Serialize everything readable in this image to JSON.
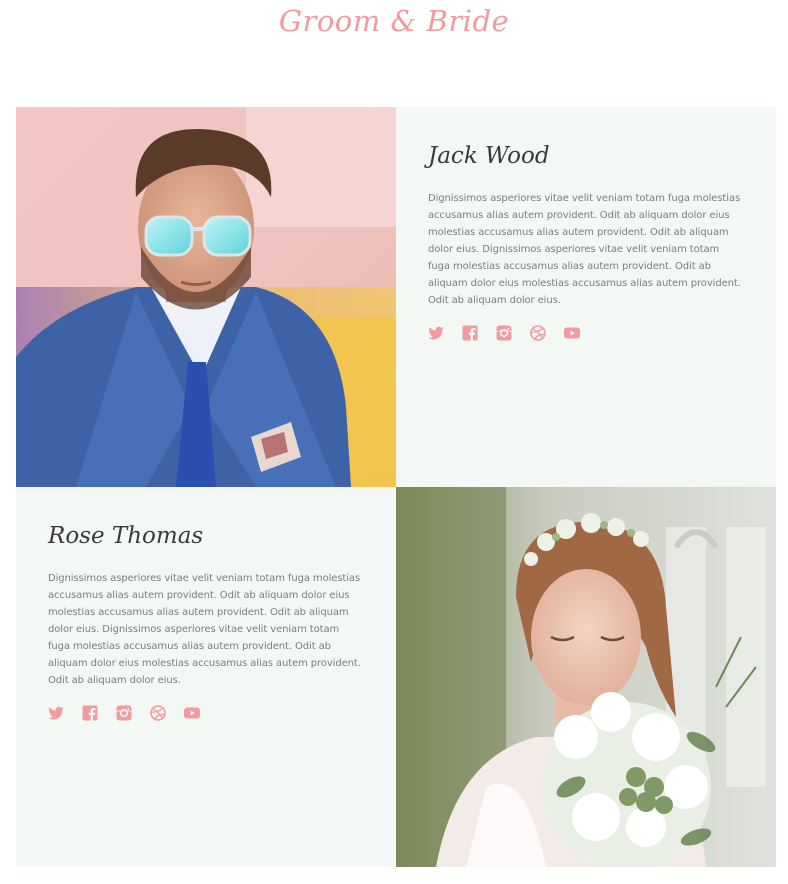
{
  "section": {
    "title": "Groom & Bride"
  },
  "accent_color": "#f29a9e",
  "card_background": "#f3f8f5",
  "groom": {
    "name": "Jack Wood",
    "bio": "Dignissimos asperiores vitae velit veniam totam fuga molestias accusamus alias autem provident. Odit ab aliquam dolor eius molestias accusamus alias autem provident. Odit ab aliquam dolor eius. Dignissimos asperiores vitae velit veniam totam fuga molestias accusamus alias autem provident. Odit ab aliquam dolor eius molestias accusamus alias autem provident. Odit ab aliquam dolor eius.",
    "social": [
      "twitter-icon",
      "facebook-icon",
      "instagram-icon",
      "dribbble-icon",
      "youtube-icon"
    ]
  },
  "bride": {
    "name": "Rose Thomas",
    "bio": "Dignissimos asperiores vitae velit veniam totam fuga molestias accusamus alias autem provident. Odit ab aliquam dolor eius molestias accusamus alias autem provident. Odit ab aliquam dolor eius. Dignissimos asperiores vitae velit veniam totam fuga molestias accusamus alias autem provident. Odit ab aliquam dolor eius molestias accusamus alias autem provident. Odit ab aliquam dolor eius.",
    "social": [
      "twitter-icon",
      "facebook-icon",
      "instagram-icon",
      "dribbble-icon",
      "youtube-icon"
    ]
  }
}
